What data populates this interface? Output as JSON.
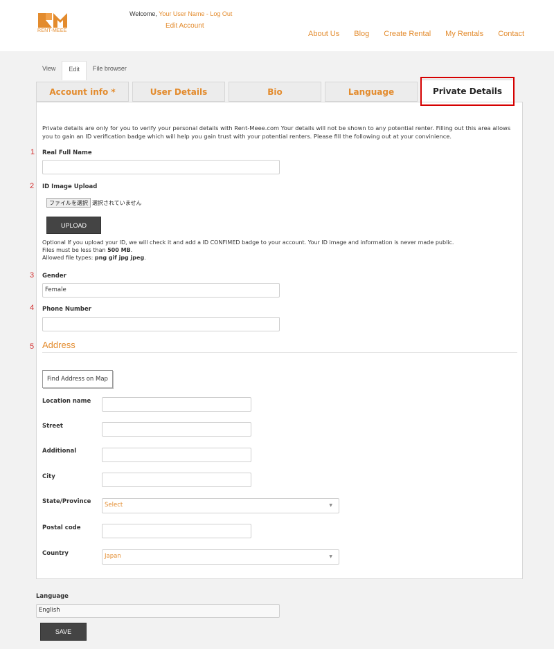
{
  "header": {
    "logo_text": "RENT-MEEE",
    "welcome_prefix": "Welcome, ",
    "user_link": "Your User Name - Log Out",
    "edit_account": "Edit Account",
    "nav": [
      "About Us",
      "Blog",
      "Create Rental",
      "My Rentals",
      "Contact"
    ]
  },
  "local_tabs": [
    "View",
    "Edit",
    "File browser"
  ],
  "local_tab_active": "Edit",
  "form_tabs": [
    "Account info *",
    "User Details",
    "Bio",
    "Language",
    "Private Details"
  ],
  "form_tab_active": "Private Details",
  "intro_text": "Private details are only for you to verify your personal details with Rent-Meee.com Your details will not be shown to any potential renter. Filling out this area allows you to gain an ID verification badge which will help you gain trust with your potential renters. Please fill the following out at your convinience.",
  "numbers": [
    "1",
    "2",
    "3",
    "4",
    "5"
  ],
  "fields": {
    "real_name": {
      "label": "Real Full Name",
      "value": ""
    },
    "id_image": {
      "label": "ID Image Upload",
      "choose_label": "ファイルを選択",
      "no_file_text": "選択されていません",
      "upload_button": "UPLOAD"
    },
    "help": {
      "line1": "Optional If you upload your ID, we will check it and add a ID CONFIMED badge to your account. Your ID image and information is never made public.",
      "size_prefix": "Files must be less than ",
      "size_value": "500 MB",
      "size_suffix": ".",
      "types_prefix": "Allowed file types: ",
      "types_value": "png gif jpg jpeg",
      "types_suffix": "."
    },
    "gender": {
      "label": "Gender",
      "value": "Female"
    },
    "phone": {
      "label": "Phone Number",
      "value": ""
    }
  },
  "address": {
    "title": "Address",
    "find_button": "Find Address on Map",
    "location_name": {
      "label": "Location name",
      "value": ""
    },
    "street": {
      "label": "Street",
      "value": ""
    },
    "additional": {
      "label": "Additional",
      "value": ""
    },
    "city": {
      "label": "City",
      "value": ""
    },
    "state": {
      "label": "State/Province",
      "value": "Select"
    },
    "postal_code": {
      "label": "Postal code",
      "value": ""
    },
    "country": {
      "label": "Country",
      "value": "Japan"
    }
  },
  "language": {
    "label": "Language",
    "value": "English"
  },
  "save_button": "SAVE",
  "colors": {
    "accent": "#e38b2d",
    "highlight": "#d50000",
    "button": "#444444"
  }
}
